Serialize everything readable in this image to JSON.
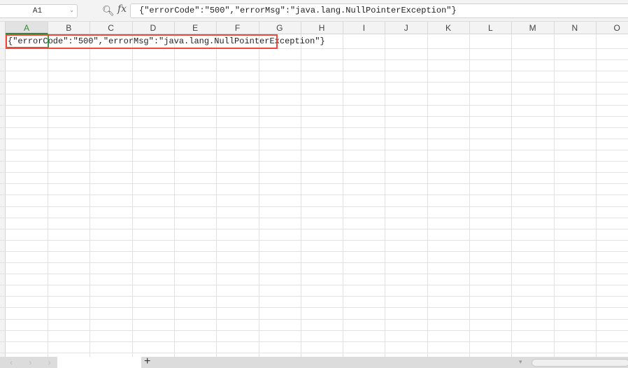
{
  "name_box": {
    "value": "A1"
  },
  "formula_bar": {
    "fx_label": "fx",
    "value": "{\"errorCode\":\"500\",\"errorMsg\":\"java.lang.NullPointerException\"}"
  },
  "columns": [
    "A",
    "B",
    "C",
    "D",
    "E",
    "F",
    "G",
    "H",
    "I",
    "J",
    "K",
    "L",
    "M",
    "N",
    "O"
  ],
  "selected_cell": "A1",
  "cell_A1": "{\"errorCode\":\"500\",\"errorMsg\":\"java.lang.NullPointerException\"}",
  "bottom_bar": {
    "nav": "‹ › ›",
    "add_sheet": "+"
  },
  "colors": {
    "selection": "#3aa04a",
    "highlight": "#f0493a"
  }
}
